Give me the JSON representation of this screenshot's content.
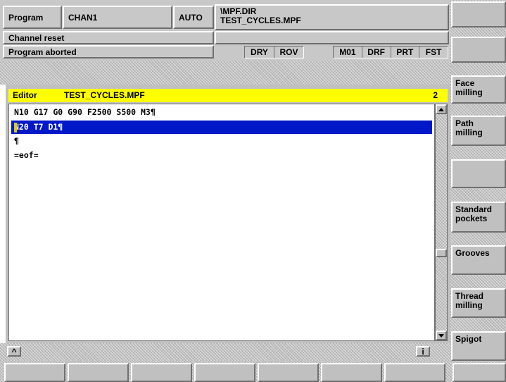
{
  "header": {
    "program_label": "Program",
    "channel": "CHAN1",
    "mode": "AUTO",
    "path_line1": "\\MPF.DIR",
    "path_line2": "TEST_CYCLES.MPF",
    "channel_status": "Channel reset",
    "program_status": "Program aborted",
    "flags_left": [
      "DRY",
      "ROV"
    ],
    "flags_right": [
      "M01",
      "DRF",
      "PRT",
      "FST"
    ]
  },
  "editor": {
    "title": "Editor",
    "filename": "TEST_CYCLES.MPF",
    "number": "2",
    "lines": [
      "N10 G17 G0 G90 F2500 S500 M3¶",
      "N20 T7 D1¶",
      "¶",
      "=eof="
    ],
    "selected_line": 1
  },
  "vertical_softkeys": [
    "",
    "",
    "Face\nmilling",
    "Path\nmilling",
    "",
    "Standard\npockets",
    "Grooves",
    "",
    "Thread\nmilling",
    "Spigot"
  ],
  "status_bar": {
    "recall_glyph": "^",
    "info_glyph": "i"
  },
  "horizontal_softkeys": [
    "",
    "",
    "",
    "",
    "",
    "",
    "",
    ""
  ],
  "colors": {
    "title_bar": "#ffff00",
    "selection": "#0018c8",
    "panel": "#c0c0c0",
    "background": "#ffffff"
  }
}
